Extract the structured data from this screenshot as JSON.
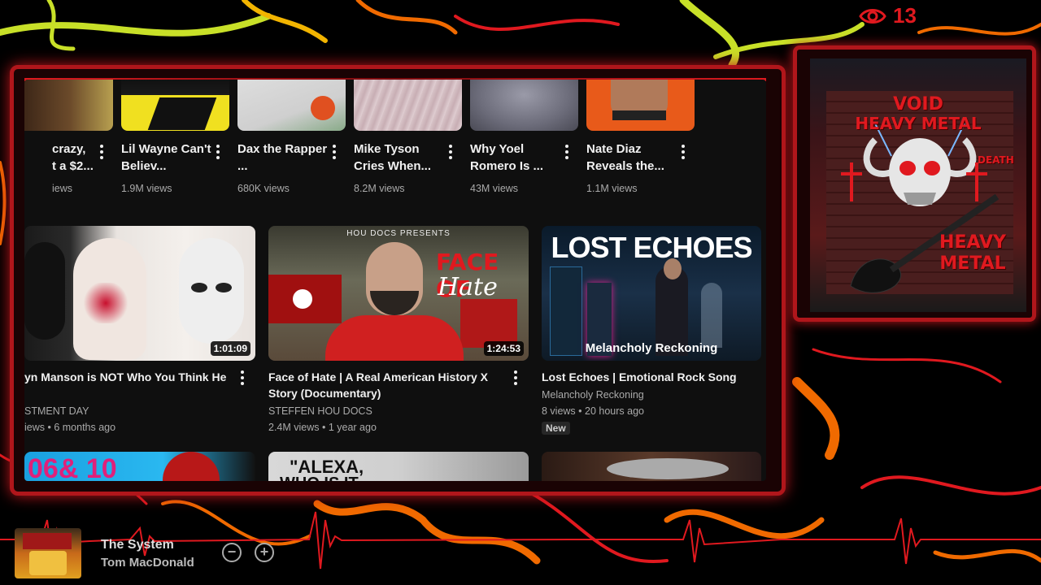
{
  "overlay": {
    "viewer_count": "13",
    "accent_color": "#e0191f"
  },
  "shorts": [
    {
      "title": "crazy, ...t a $2...",
      "title_lines": [
        "crazy,",
        "t a $2..."
      ],
      "views": "iews"
    },
    {
      "title": "Lil Wayne Can't Believ...",
      "views": "1.9M views"
    },
    {
      "title": "Dax the Rapper ...",
      "views": "680K views"
    },
    {
      "title": "Mike Tyson Cries When...",
      "views": "8.2M views"
    },
    {
      "title": "Why Yoel Romero Is ...",
      "views": "43M views"
    },
    {
      "title": "Nate Diaz Reveals the...",
      "views": "1.1M views"
    }
  ],
  "videos": [
    {
      "title": "yn Manson is NOT Who You Think He",
      "duration": "1:01:09",
      "channel": "STMENT DAY",
      "meta": "iews • 6 months ago"
    },
    {
      "title": "Face of Hate | A Real American History X Story (Documentary)",
      "duration": "1:24:53",
      "thumb_header": "HOU DOCS PRESENTS",
      "thumb_title_1": "FACE OF",
      "thumb_title_2": "Hate",
      "channel": "STEFFEN HOU DOCS",
      "meta": "2.4M views • 1 year ago"
    },
    {
      "title": "Lost Echoes | Emotional Rock Song",
      "thumb_title": "LOST ECHOES",
      "thumb_caption": "Melancholy Reckoning",
      "channel": "Melancholy Reckoning",
      "meta": "8 views • 20 hours ago",
      "badge": "New"
    }
  ],
  "row3_peek": {
    "item1_text": "06& 10",
    "item2_text": "\"ALEXA,",
    "item2_text_2": "WHO IS IT"
  },
  "album_art": {
    "line1": "VOID",
    "line2": "HEAVY METAL",
    "line3": "DEATH",
    "line4": "HEAVY",
    "line5": "METAL"
  },
  "now_playing": {
    "title": "The System",
    "artist": "Tom MacDonald",
    "minus_label": "−",
    "plus_label": "+"
  }
}
